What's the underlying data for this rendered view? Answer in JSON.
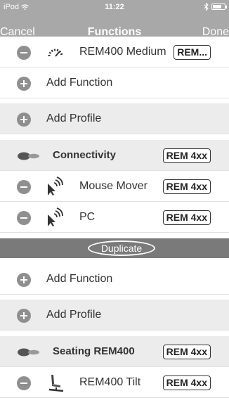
{
  "status_bar": {
    "carrier": "iPod",
    "time": "11:22",
    "battery_level": 0.75
  },
  "nav": {
    "left": "Cancel",
    "title": "Functions",
    "right": "Done"
  },
  "rows": {
    "rem_medium": {
      "label": "REM400 Medium",
      "badge": "REM...",
      "icon": "gauge-icon"
    },
    "add_function_1": {
      "label": "Add Function"
    },
    "add_profile_1": {
      "label": "Add Profile"
    },
    "connectivity": {
      "label": "Connectivity",
      "badge": "REM 4xx",
      "icon": "profile-toggle-icon"
    },
    "mouse_mover": {
      "label": "Mouse Mover",
      "badge": "REM 4xx",
      "icon": "wireless-pointer-icon"
    },
    "pc": {
      "label": "PC",
      "badge": "REM 4xx",
      "icon": "wireless-pointer-icon"
    },
    "add_function_2": {
      "label": "Add Function"
    },
    "add_profile_2": {
      "label": "Add Profile"
    },
    "seating": {
      "label": "Seating REM400",
      "badge": "REM 4xx",
      "icon": "profile-toggle-icon"
    },
    "tilt": {
      "label": "REM400 Tilt",
      "badge": "REM 4xx",
      "icon": "seat-tilt-icon"
    }
  },
  "duplicate": {
    "label": "Duplicate"
  },
  "colors": {
    "nav_bg": "#a8a8a8",
    "duplicate_bar": "#7a7a7a",
    "section_bg": "#ececec",
    "control_gray": "#8f8f8f"
  }
}
